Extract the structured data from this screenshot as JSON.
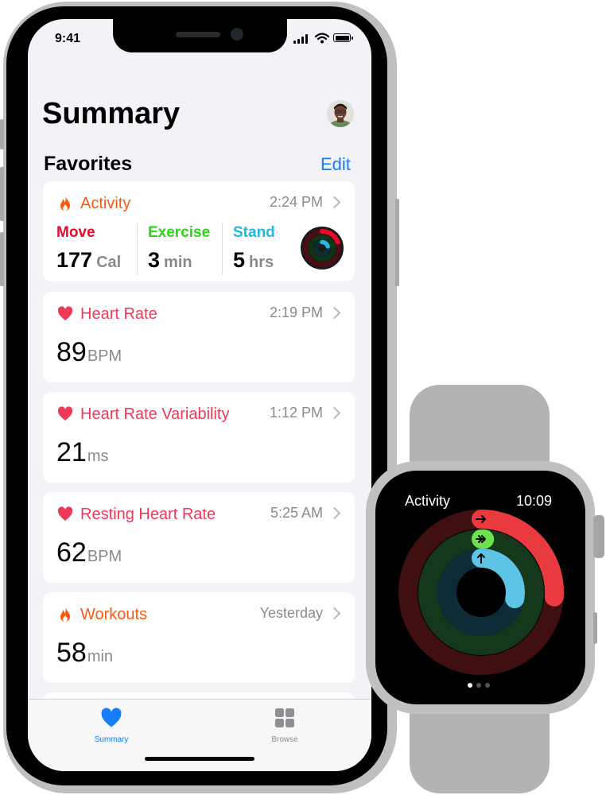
{
  "phone": {
    "status": {
      "time": "9:41"
    },
    "title": "Summary",
    "favorites_label": "Favorites",
    "edit_label": "Edit",
    "activity_card": {
      "title": "Activity",
      "time": "2:24 PM",
      "color": "#fa5a0f",
      "metrics": [
        {
          "label": "Move",
          "value": "177",
          "unit": "Cal",
          "color": "#e6092a"
        },
        {
          "label": "Exercise",
          "value": "3",
          "unit": "min",
          "color": "#2ed31c"
        },
        {
          "label": "Stand",
          "value": "5",
          "unit": "hrs",
          "color": "#23b6e3"
        }
      ]
    },
    "cards": [
      {
        "title": "Heart Rate",
        "time": "2:19 PM",
        "value": "89",
        "unit": "BPM",
        "icon": "heart-icon",
        "color": "#f03858"
      },
      {
        "title": "Heart Rate Variability",
        "time": "1:12 PM",
        "value": "21",
        "unit": "ms",
        "icon": "heart-icon",
        "color": "#f03858"
      },
      {
        "title": "Resting Heart Rate",
        "time": "5:25 AM",
        "value": "62",
        "unit": "BPM",
        "icon": "heart-icon",
        "color": "#f03858"
      },
      {
        "title": "Workouts",
        "time": "Yesterday",
        "value": "58",
        "unit": "min",
        "icon": "flame-icon",
        "color": "#fa5a0f"
      }
    ],
    "tabs": [
      {
        "label": "Summary",
        "icon": "heart-icon",
        "active": true,
        "color": "#147efb"
      },
      {
        "label": "Browse",
        "icon": "grid-icon",
        "active": false,
        "color": "#8e8e93"
      }
    ]
  },
  "watch": {
    "title": "Activity",
    "time": "10:09",
    "page_count": 3,
    "active_page": 1,
    "rings": [
      {
        "name": "move",
        "progress": 0.26,
        "color": "#e83a3f",
        "track": "#3f0f12",
        "icon": "arrow-right-icon"
      },
      {
        "name": "exercise",
        "progress": 0.01,
        "color": "#6ce24c",
        "track": "#15381c",
        "icon": "double-arrow-icon"
      },
      {
        "name": "stand",
        "progress": 0.28,
        "color": "#5ec4e6",
        "track": "#0e2c38",
        "icon": "arrow-up-icon"
      }
    ]
  }
}
